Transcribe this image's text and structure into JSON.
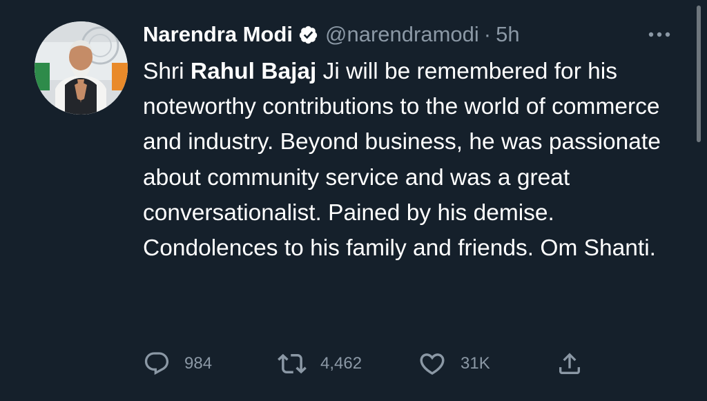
{
  "tweet": {
    "author": {
      "display_name": "Narendra Modi",
      "verified": true,
      "handle": "@narendramodi",
      "separator": "·",
      "time": "5h",
      "avatar_icon": "profile-photo"
    },
    "text": {
      "prefix": "Shri ",
      "bold": "Rahul Bajaj",
      "body": " Ji will be remembered for his noteworthy contributions to the world of commerce and industry. Beyond business, he was passionate about community service and was a great conversationalist. Pained by his demise. Condolences to his family and friends. Om Shanti."
    },
    "actions": {
      "reply": {
        "icon": "reply-icon",
        "count": "984"
      },
      "retweet": {
        "icon": "retweet-icon",
        "count": "4,462"
      },
      "like": {
        "icon": "heart-icon",
        "count": "31K"
      },
      "share": {
        "icon": "share-icon"
      }
    },
    "more_icon": "more-options-icon"
  },
  "theme": {
    "background": "#15202b",
    "text_primary": "#ffffff",
    "text_secondary": "#8b98a5",
    "verified_badge": "#ffffff"
  }
}
